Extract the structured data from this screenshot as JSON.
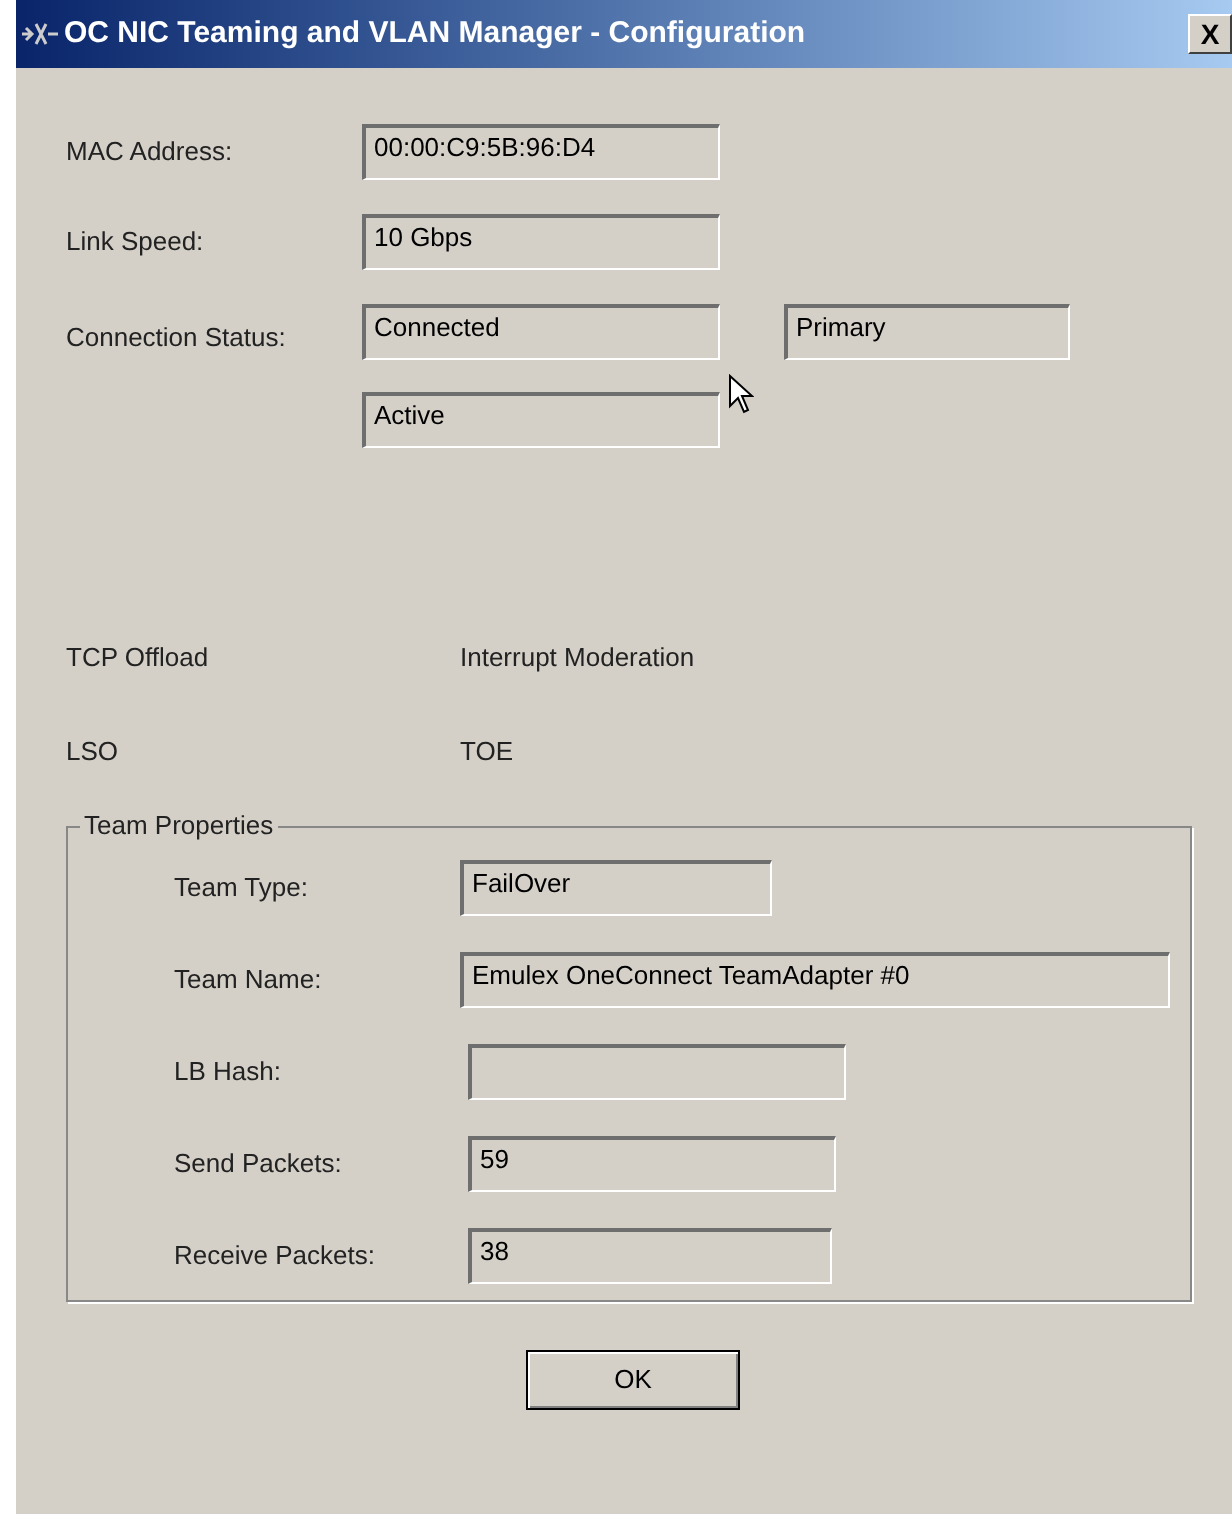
{
  "window": {
    "title": "OC NIC Teaming and VLAN Manager - Configuration",
    "close": "X"
  },
  "fields": [
    {
      "label": "MAC Address:",
      "value": "00:00:C9:5B:96:D4"
    },
    {
      "label": "Link Speed:",
      "value": "10 Gbps"
    }
  ],
  "connection": {
    "label": "Connection Status:",
    "value": "Connected",
    "role": "Primary",
    "state": "Active"
  },
  "features": [
    [
      "TCP Offload",
      "Interrupt Moderation"
    ],
    [
      "LSO",
      "TOE"
    ]
  ],
  "team": {
    "title": "Team Properties",
    "rows": [
      {
        "label": "Team Type:",
        "value": "FailOver"
      },
      {
        "label": "Team Name:",
        "value": "Emulex OneConnect TeamAdapter #0"
      },
      {
        "label": "LB Hash:"
      },
      {
        "label": "Send Packets:",
        "value": "59"
      },
      {
        "label": "Receive Packets:",
        "value": "38"
      }
    ]
  },
  "buttons": [
    "OK"
  ]
}
